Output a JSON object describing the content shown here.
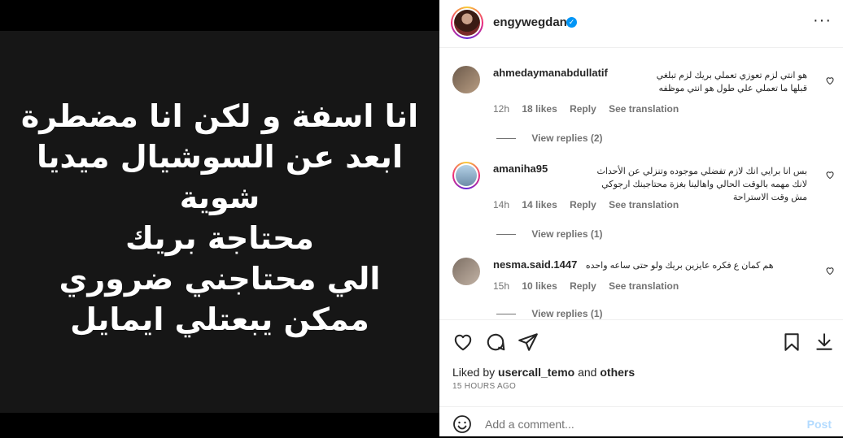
{
  "post": {
    "image_text": [
      "انا اسفة و لكن انا مضطرة",
      "ابعد عن السوشيال ميديا",
      "شوية",
      "محتاجة بريك",
      "الي محتاجني ضروري",
      "ممكن يبعتلي ايمايل"
    ]
  },
  "header": {
    "username": "engywegdan",
    "verified": true,
    "more_label": "···"
  },
  "comments": [
    {
      "user": "ahmedaymanabdullatif",
      "text": "هو انتي لزم تعوزي تعملي بريك لزم تبلغي قبلها ما تعملي علي طول هو انتي موظفه",
      "time": "12h",
      "likes": "18 likes",
      "reply": "Reply",
      "translate": "See translation",
      "view_replies": "View replies (2)"
    },
    {
      "user": "amaniha95",
      "text": "بس انا برايي انك لازم تفضلي موجوده وتنزلي عن الأحداث لانك مهمه بالوقت الحالي واهالينا بغزة محتاجينك ارجوكي مش وقت الاستراحة",
      "time": "14h",
      "likes": "14 likes",
      "reply": "Reply",
      "translate": "See translation",
      "view_replies": "View replies (1)"
    },
    {
      "user": "nesma.said.1447",
      "text": "هم كمان ع فكره عايزين بريك ولو حتى ساعه واحده",
      "time": "15h",
      "likes": "10 likes",
      "reply": "Reply",
      "translate": "See translation",
      "view_replies": "View replies (1)"
    }
  ],
  "likes": {
    "prefix": "Liked by",
    "user": "usercall_temo",
    "and": "and",
    "others": "others"
  },
  "timestamp": "15 HOURS AGO",
  "add_comment": {
    "placeholder": "Add a comment...",
    "post": "Post"
  },
  "icons": {
    "like": "heart-icon",
    "comment": "comment-icon",
    "share": "share-icon",
    "save": "bookmark-icon",
    "download": "download-icon",
    "emoji": "emoji-icon"
  }
}
